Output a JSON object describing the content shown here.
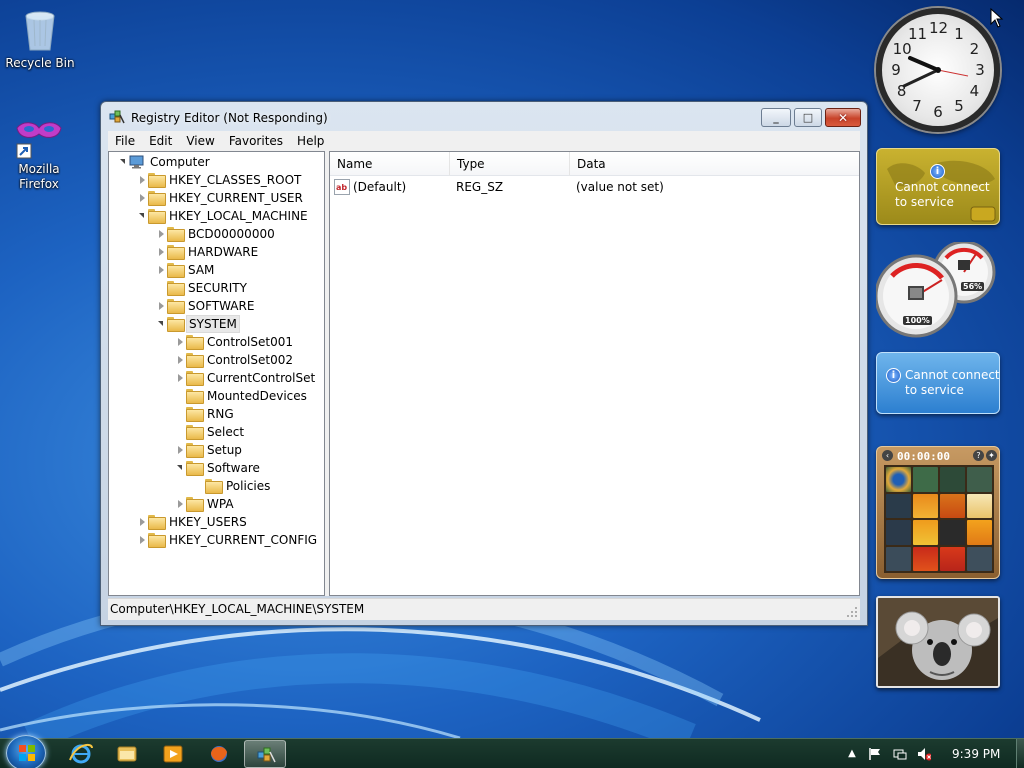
{
  "desktop": {
    "icons": [
      {
        "label": "Recycle Bin"
      },
      {
        "label": "Mozilla Firefox"
      }
    ]
  },
  "window": {
    "title": "Registry Editor (Not Responding)",
    "caption_buttons": {
      "minimize": "_",
      "maximize": "□",
      "close": "✕"
    },
    "menu": [
      "File",
      "Edit",
      "View",
      "Favorites",
      "Help"
    ],
    "tree": [
      {
        "label": "Computer",
        "level": 0,
        "expander": "open",
        "icon": "computer-icon"
      },
      {
        "label": "HKEY_CLASSES_ROOT",
        "level": 1,
        "expander": "closed"
      },
      {
        "label": "HKEY_CURRENT_USER",
        "level": 1,
        "expander": "closed"
      },
      {
        "label": "HKEY_LOCAL_MACHINE",
        "level": 1,
        "expander": "open"
      },
      {
        "label": "BCD00000000",
        "level": 2,
        "expander": "closed"
      },
      {
        "label": "HARDWARE",
        "level": 2,
        "expander": "closed"
      },
      {
        "label": "SAM",
        "level": 2,
        "expander": "closed"
      },
      {
        "label": "SECURITY",
        "level": 2,
        "expander": "none"
      },
      {
        "label": "SOFTWARE",
        "level": 2,
        "expander": "closed"
      },
      {
        "label": "SYSTEM",
        "level": 2,
        "expander": "open",
        "selected": true
      },
      {
        "label": "ControlSet001",
        "level": 3,
        "expander": "closed"
      },
      {
        "label": "ControlSet002",
        "level": 3,
        "expander": "closed"
      },
      {
        "label": "CurrentControlSet",
        "level": 3,
        "expander": "closed"
      },
      {
        "label": "MountedDevices",
        "level": 3,
        "expander": "none"
      },
      {
        "label": "RNG",
        "level": 3,
        "expander": "none"
      },
      {
        "label": "Select",
        "level": 3,
        "expander": "none"
      },
      {
        "label": "Setup",
        "level": 3,
        "expander": "closed"
      },
      {
        "label": "Software",
        "level": 3,
        "expander": "open"
      },
      {
        "label": "Policies",
        "level": 4,
        "expander": "none"
      },
      {
        "label": "WPA",
        "level": 3,
        "expander": "closed"
      },
      {
        "label": "HKEY_USERS",
        "level": 1,
        "expander": "closed"
      },
      {
        "label": "HKEY_CURRENT_CONFIG",
        "level": 1,
        "expander": "closed"
      }
    ],
    "columns": [
      "Name",
      "Type",
      "Data"
    ],
    "values": [
      {
        "name": "(Default)",
        "type": "REG_SZ",
        "data": "(value not set)"
      }
    ],
    "status": "Computer\\HKEY_LOCAL_MACHINE\\SYSTEM"
  },
  "gadgets": {
    "weather_message": "Cannot connect to service",
    "currency_message": "Cannot connect to service",
    "cpu_percent": "100%",
    "memory_percent": "56%",
    "puzzle_timer": "00:00:00",
    "clock_numbers": [
      "12",
      "1",
      "2",
      "3",
      "4",
      "5",
      "6",
      "7",
      "8",
      "9",
      "10",
      "11"
    ]
  },
  "taskbar": {
    "time": "9:39 PM"
  },
  "colors": {
    "accent": "#1d63c2",
    "taskbar": "#0f2a21",
    "selection": "#e8e8e8"
  }
}
